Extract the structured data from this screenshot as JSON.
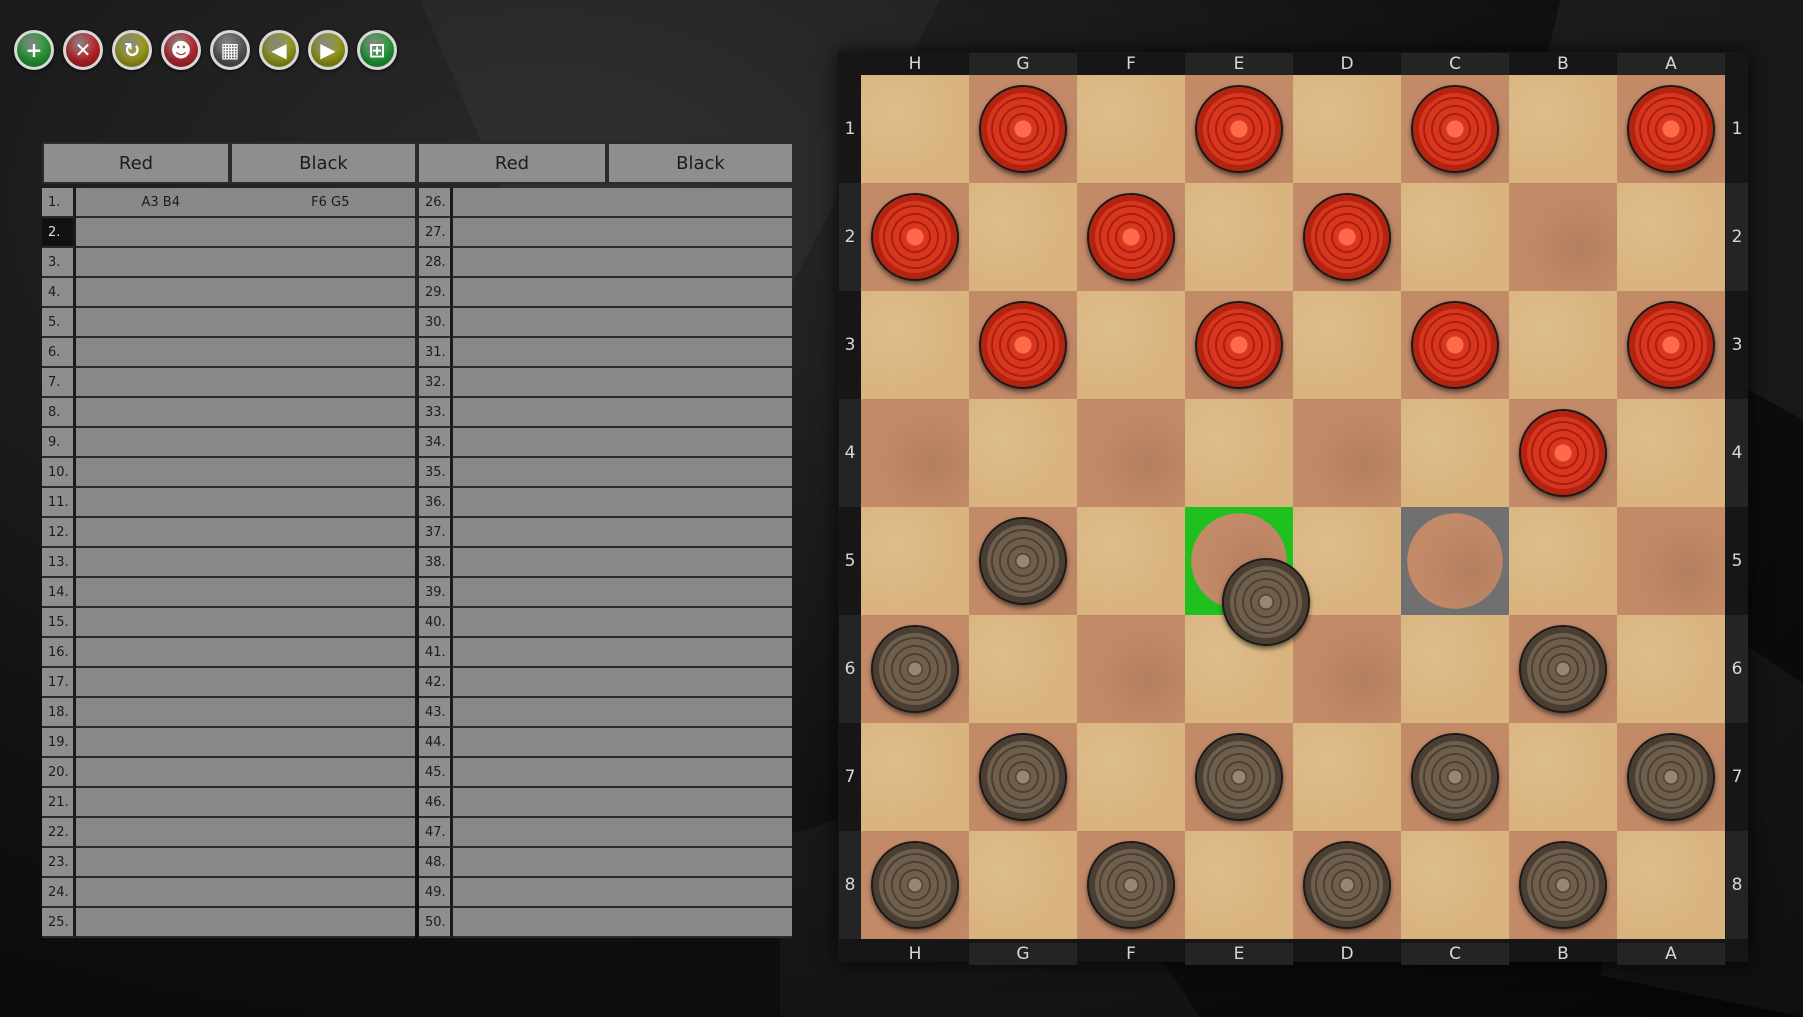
{
  "toolbar": [
    {
      "name": "new-game-button",
      "glyph": "+",
      "color": "#27a33a",
      "icon": "plus-icon"
    },
    {
      "name": "close-game-button",
      "glyph": "✕",
      "color": "#c7262b",
      "icon": "close-icon"
    },
    {
      "name": "restart-button",
      "glyph": "↻",
      "color": "#a6a31d",
      "icon": "refresh-icon"
    },
    {
      "name": "players-button",
      "glyph": "☻",
      "color": "#c22b37",
      "icon": "users-icon"
    },
    {
      "name": "grid-button",
      "glyph": "▦",
      "color": "#5a5a5a",
      "icon": "grid-icon"
    },
    {
      "name": "undo-button",
      "glyph": "◀",
      "color": "#9ca21c",
      "icon": "arrow-left-icon"
    },
    {
      "name": "redo-button",
      "glyph": "▶",
      "color": "#9ca21c",
      "icon": "arrow-right-icon"
    },
    {
      "name": "network-button",
      "glyph": "⊞",
      "color": "#27a33a",
      "icon": "network-icon"
    }
  ],
  "movelist": {
    "headers": [
      "Red",
      "Black",
      "Red",
      "Black"
    ],
    "active_row": 2,
    "moves": [
      {
        "num": "1.",
        "red": "A3 B4",
        "black": "F6 G5"
      }
    ]
  },
  "board": {
    "files": [
      "H",
      "G",
      "F",
      "E",
      "D",
      "C",
      "B",
      "A"
    ],
    "ranks": [
      "1",
      "2",
      "3",
      "4",
      "5",
      "6",
      "7",
      "8"
    ],
    "pieces": [
      {
        "rank": 1,
        "col": 1,
        "color": "red"
      },
      {
        "rank": 1,
        "col": 3,
        "color": "red"
      },
      {
        "rank": 1,
        "col": 5,
        "color": "red"
      },
      {
        "rank": 1,
        "col": 7,
        "color": "red"
      },
      {
        "rank": 2,
        "col": 0,
        "color": "red"
      },
      {
        "rank": 2,
        "col": 2,
        "color": "red"
      },
      {
        "rank": 2,
        "col": 4,
        "color": "red"
      },
      {
        "rank": 3,
        "col": 1,
        "color": "red"
      },
      {
        "rank": 3,
        "col": 3,
        "color": "red"
      },
      {
        "rank": 3,
        "col": 5,
        "color": "red"
      },
      {
        "rank": 3,
        "col": 7,
        "color": "red"
      },
      {
        "rank": 4,
        "col": 6,
        "color": "red"
      },
      {
        "rank": 5,
        "col": 1,
        "color": "black"
      },
      {
        "rank": 6,
        "col": 0,
        "color": "black"
      },
      {
        "rank": 6,
        "col": 6,
        "color": "black"
      },
      {
        "rank": 7,
        "col": 1,
        "color": "black"
      },
      {
        "rank": 7,
        "col": 3,
        "color": "black"
      },
      {
        "rank": 7,
        "col": 5,
        "color": "black"
      },
      {
        "rank": 7,
        "col": 7,
        "color": "black"
      },
      {
        "rank": 8,
        "col": 0,
        "color": "black"
      },
      {
        "rank": 8,
        "col": 2,
        "color": "black"
      },
      {
        "rank": 8,
        "col": 4,
        "color": "black"
      },
      {
        "rank": 8,
        "col": 6,
        "color": "black"
      }
    ],
    "dragging_piece": {
      "color": "black",
      "from": "C5",
      "hover": "E5"
    },
    "highlight_target": {
      "rank": 5,
      "col": 3
    },
    "highlight_origin": {
      "rank": 5,
      "col": 5
    },
    "colors": {
      "light": "#d9b47e",
      "dark": "#c38a68",
      "target": "#1fc11f"
    }
  }
}
